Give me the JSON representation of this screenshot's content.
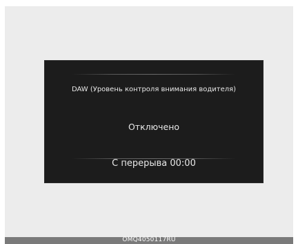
{
  "display": {
    "title": "DAW (Уровень контроля внимания водителя)",
    "status": "Отключено",
    "since_break": "С перерыва 00:00"
  },
  "caption": "OMQ4050117RU",
  "colors": {
    "background": "#ececec",
    "screen": "#1c1c1c",
    "text": "#e8e8e8",
    "caption_bar": "#7a7a7a"
  }
}
